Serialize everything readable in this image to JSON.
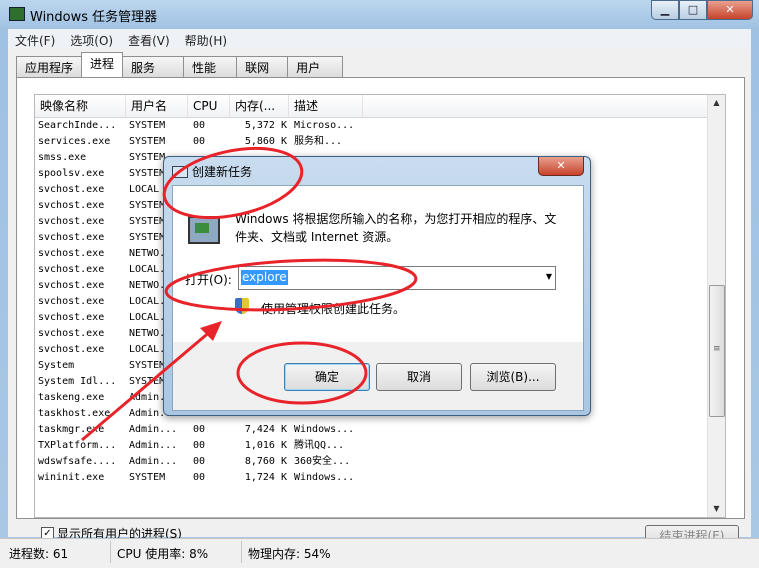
{
  "window": {
    "title": "Windows 任务管理器"
  },
  "menu": [
    "文件(F)",
    "选项(O)",
    "查看(V)",
    "帮助(H)"
  ],
  "tabs": [
    "应用程序",
    "进程",
    "服务",
    "性能",
    "联网",
    "用户"
  ],
  "columns": [
    "映像名称",
    "用户名",
    "CPU",
    "内存(...",
    "描述"
  ],
  "rows": [
    {
      "image": "SearchInde...",
      "user": "SYSTEM",
      "cpu": "00",
      "mem": "5,372 K",
      "desc": "Microso..."
    },
    {
      "image": "services.exe",
      "user": "SYSTEM",
      "cpu": "00",
      "mem": "5,860 K",
      "desc": "服务和..."
    },
    {
      "image": "smss.exe",
      "user": "SYSTEM",
      "cpu": "",
      "mem": "",
      "desc": ""
    },
    {
      "image": "spoolsv.exe",
      "user": "SYSTEM",
      "cpu": "",
      "mem": "",
      "desc": ""
    },
    {
      "image": "svchost.exe",
      "user": "LOCAL",
      "cpu": "",
      "mem": "",
      "desc": ""
    },
    {
      "image": "svchost.exe",
      "user": "SYSTEM",
      "cpu": "",
      "mem": "",
      "desc": ""
    },
    {
      "image": "svchost.exe",
      "user": "SYSTEM",
      "cpu": "",
      "mem": "",
      "desc": ""
    },
    {
      "image": "svchost.exe",
      "user": "SYSTEM",
      "cpu": "",
      "mem": "",
      "desc": ""
    },
    {
      "image": "svchost.exe",
      "user": "NETWO...",
      "cpu": "",
      "mem": "",
      "desc": ""
    },
    {
      "image": "svchost.exe",
      "user": "LOCAL...",
      "cpu": "",
      "mem": "",
      "desc": ""
    },
    {
      "image": "svchost.exe",
      "user": "NETWO...",
      "cpu": "",
      "mem": "",
      "desc": ""
    },
    {
      "image": "svchost.exe",
      "user": "LOCAL...",
      "cpu": "",
      "mem": "",
      "desc": ""
    },
    {
      "image": "svchost.exe",
      "user": "LOCAL...",
      "cpu": "",
      "mem": "",
      "desc": ""
    },
    {
      "image": "svchost.exe",
      "user": "NETWO...",
      "cpu": "",
      "mem": "",
      "desc": ""
    },
    {
      "image": "svchost.exe",
      "user": "LOCAL...",
      "cpu": "",
      "mem": "",
      "desc": ""
    },
    {
      "image": "System",
      "user": "SYSTEM",
      "cpu": "",
      "mem": "",
      "desc": ""
    },
    {
      "image": "System Idl...",
      "user": "SYSTEM",
      "cpu": "",
      "mem": "",
      "desc": ""
    },
    {
      "image": "taskeng.exe",
      "user": "Admin...",
      "cpu": "",
      "mem": "",
      "desc": ""
    },
    {
      "image": "taskhost.exe",
      "user": "Admin...",
      "cpu": "",
      "mem": "",
      "desc": ""
    },
    {
      "image": "taskmgr.exe",
      "user": "Admin...",
      "cpu": "00",
      "mem": "7,424 K",
      "desc": "Windows..."
    },
    {
      "image": "TXPlatform...",
      "user": "Admin...",
      "cpu": "00",
      "mem": "1,016 K",
      "desc": "腾讯QQ..."
    },
    {
      "image": "wdswfsafe....",
      "user": "Admin...",
      "cpu": "00",
      "mem": "8,760 K",
      "desc": "360安全..."
    },
    {
      "image": "wininit.exe",
      "user": "SYSTEM",
      "cpu": "00",
      "mem": "1,724 K",
      "desc": "Windows..."
    }
  ],
  "show_all_users": "显示所有用户的进程(S)",
  "end_process": "结束进程(E)",
  "status": {
    "processes": "进程数: 61",
    "cpu": "CPU 使用率: 8%",
    "memory": "物理内存: 54%"
  },
  "dialog": {
    "title": "创建新任务",
    "description": "Windows 将根据您所输入的名称，为您打开相应的程序、文件夹、文档或 Internet 资源。",
    "open_label": "打开(O):",
    "open_value": "explore",
    "admin_text": "使用管理权限创建此任务。",
    "ok": "确定",
    "cancel": "取消",
    "browse": "浏览(B)..."
  },
  "colors": {
    "annotation": "#e8232a",
    "selection": "#3399ff"
  }
}
